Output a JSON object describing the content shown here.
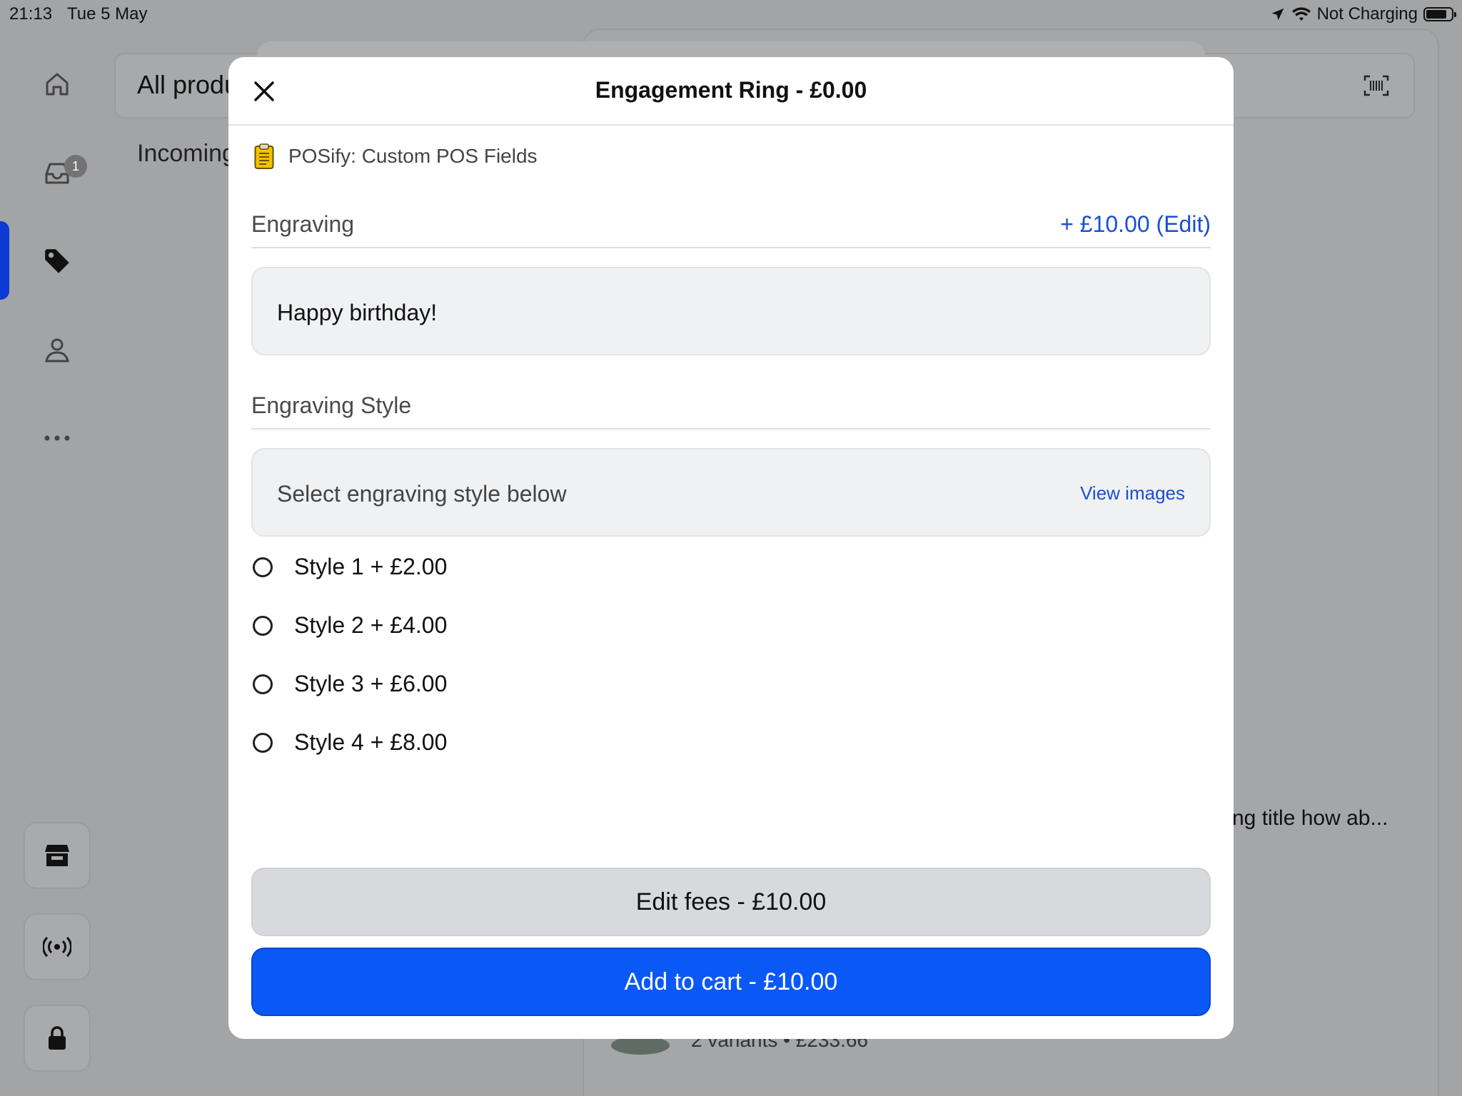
{
  "status_bar": {
    "time": "21:13",
    "date": "Tue 5 May",
    "battery_status": "Not Charging"
  },
  "background": {
    "search_label": "All produ",
    "incoming_label": "Incoming",
    "inbox_badge": "1",
    "product_title_snippet": "ng title how ab...",
    "variants_snippet": "2 variants  •  £233.66"
  },
  "modal": {
    "title": "Engagement Ring - £0.00",
    "app_name": "POSify: Custom POS Fields",
    "engraving": {
      "label": "Engraving",
      "fee_link": "+ £10.00 (Edit)",
      "value": "Happy birthday!"
    },
    "engraving_style": {
      "label": "Engraving Style",
      "prompt": "Select engraving style below",
      "view_images": "View images",
      "options": [
        {
          "label": "Style 1 + £2.00",
          "selected": false
        },
        {
          "label": "Style 2 + £4.00",
          "selected": false
        },
        {
          "label": "Style 3 + £6.00",
          "selected": false
        },
        {
          "label": "Style 4 + £8.00",
          "selected": false
        }
      ]
    },
    "edit_fees_button": "Edit fees - £10.00",
    "add_to_cart_button": "Add to cart - £10.00"
  },
  "icons": {
    "close": "close-icon",
    "clipboard": "clipboard-icon",
    "home": "home-icon",
    "inbox": "inbox-icon",
    "tag": "tag-icon",
    "person": "person-icon",
    "more": "more-icon",
    "store": "store-icon",
    "broadcast": "broadcast-icon",
    "lock": "lock-icon",
    "barcode": "barcode-scan-icon"
  },
  "colors": {
    "accent": "#0a58f6",
    "link": "#1a4fd1",
    "active_nav": "#0b3ad4"
  }
}
